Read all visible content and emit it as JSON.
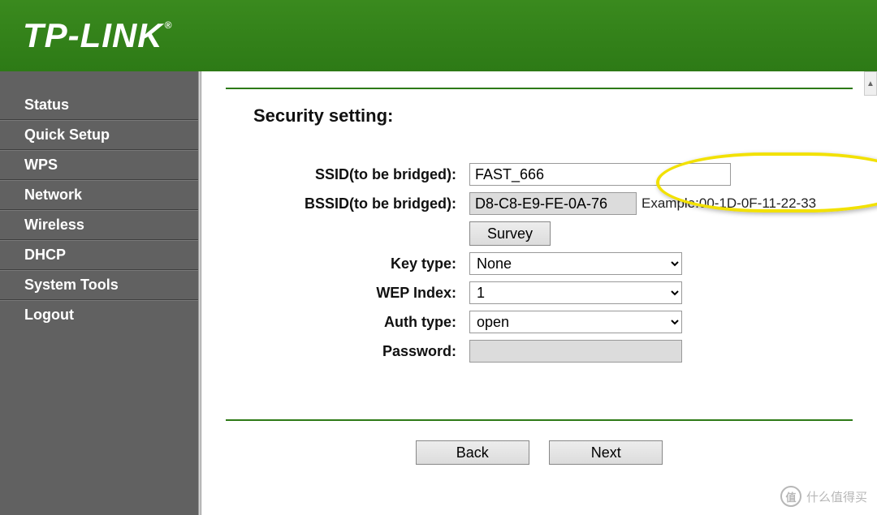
{
  "brand": "TP-LINK",
  "sidebar": {
    "items": [
      {
        "label": "Status"
      },
      {
        "label": "Quick Setup"
      },
      {
        "label": "WPS"
      },
      {
        "label": "Network"
      },
      {
        "label": "Wireless"
      },
      {
        "label": "DHCP"
      },
      {
        "label": "System Tools"
      },
      {
        "label": "Logout"
      }
    ]
  },
  "page": {
    "title": "Security setting:"
  },
  "form": {
    "ssid_label": "SSID(to be bridged):",
    "ssid_value": "FAST_666",
    "bssid_label": "BSSID(to be bridged):",
    "bssid_value": "D8-C8-E9-FE-0A-76",
    "bssid_example": "Example:00-1D-0F-11-22-33",
    "survey_label": "Survey",
    "key_type_label": "Key type:",
    "key_type_value": "None",
    "wep_index_label": "WEP Index:",
    "wep_index_value": "1",
    "auth_type_label": "Auth type:",
    "auth_type_value": "open",
    "password_label": "Password:",
    "password_value": ""
  },
  "buttons": {
    "back": "Back",
    "next": "Next"
  },
  "watermark": {
    "badge": "值",
    "text": "什么值得买"
  }
}
